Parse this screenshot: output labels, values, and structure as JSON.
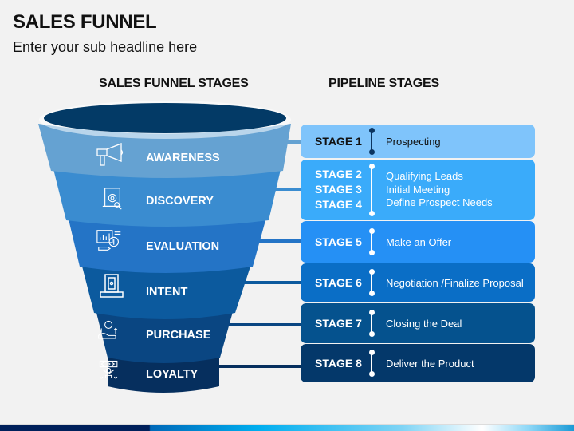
{
  "header": {
    "title": "SALES FUNNEL",
    "subtitle": "Enter your sub headline here"
  },
  "columns": {
    "left_heading": "SALES FUNNEL STAGES",
    "right_heading": "PIPELINE STAGES"
  },
  "funnel": {
    "rim_color": "#033a66",
    "segments": [
      {
        "label": "AWARENESS",
        "icon": "megaphone-icon",
        "color": "#65a2d2"
      },
      {
        "label": "DISCOVERY",
        "icon": "document-target-icon",
        "color": "#3a8cd0"
      },
      {
        "label": "EVALUATION",
        "icon": "analytics-bulb-icon",
        "color": "#2474c6"
      },
      {
        "label": "INTENT",
        "icon": "banknote-icon",
        "color": "#0c5a9e"
      },
      {
        "label": "PURCHASE",
        "icon": "money-growth-icon",
        "color": "#0a4682"
      },
      {
        "label": "LOYALTY",
        "icon": "customer-loyalty-icon",
        "color": "#062f5e"
      }
    ]
  },
  "pipeline": [
    {
      "stages": [
        "STAGE 1"
      ],
      "descriptions": [
        "Prospecting"
      ],
      "color": "#7fc4fb",
      "text_color": "#111111",
      "sep_color": "#0b3560"
    },
    {
      "stages": [
        "STAGE 2",
        "STAGE 3",
        "STAGE 4"
      ],
      "descriptions": [
        "Qualifying Leads",
        "Initial Meeting",
        "Define Prospect Needs"
      ],
      "color": "#3aabfa",
      "text_color": "#ffffff",
      "sep_color": "#ffffff"
    },
    {
      "stages": [
        "STAGE 5"
      ],
      "descriptions": [
        "Make an Offer"
      ],
      "color": "#2590f5",
      "text_color": "#ffffff",
      "sep_color": "#ffffff"
    },
    {
      "stages": [
        "STAGE 6"
      ],
      "descriptions": [
        "Negotiation /Finalize Proposal"
      ],
      "color": "#0a6ec6",
      "text_color": "#ffffff",
      "sep_color": "#ffffff"
    },
    {
      "stages": [
        "STAGE 7"
      ],
      "descriptions": [
        "Closing the Deal"
      ],
      "color": "#05528e",
      "text_color": "#ffffff",
      "sep_color": "#ffffff"
    },
    {
      "stages": [
        "STAGE 8"
      ],
      "descriptions": [
        "Deliver the Product"
      ],
      "color": "#04386a",
      "text_color": "#ffffff",
      "sep_color": "#ffffff"
    }
  ]
}
